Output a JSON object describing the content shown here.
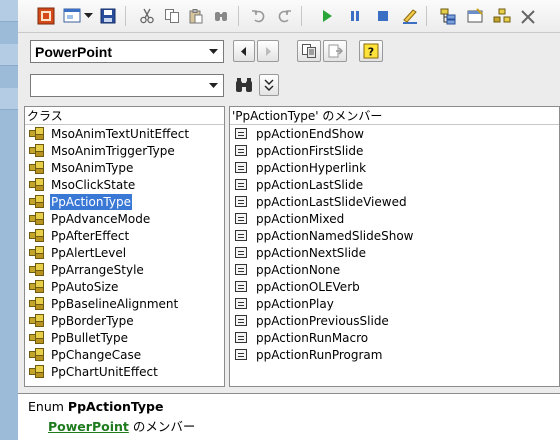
{
  "toolbar": {
    "icons": [
      "excel-view-icon",
      "insert-userform-icon",
      "dropdown-chevron-icon",
      "save-icon",
      "cut-icon",
      "copy-icon",
      "paste-icon",
      "find-icon",
      "undo-icon",
      "redo-icon",
      "run-icon",
      "break-icon",
      "reset-icon",
      "design-mode-icon",
      "project-explorer-icon",
      "properties-icon",
      "object-browser-icon",
      "toolbox-icon"
    ]
  },
  "library_select": {
    "value": "PowerPoint"
  },
  "search_select": {
    "value": ""
  },
  "classes": {
    "header": "クラス",
    "items": [
      "MsoAnimTextUnitEffect",
      "MsoAnimTriggerType",
      "MsoAnimType",
      "MsoClickState",
      "PpActionType",
      "PpAdvanceMode",
      "PpAfterEffect",
      "PpAlertLevel",
      "PpArrangeStyle",
      "PpAutoSize",
      "PpBaselineAlignment",
      "PpBorderType",
      "PpBulletType",
      "PpChangeCase",
      "PpChartUnitEffect"
    ],
    "selected": "PpActionType"
  },
  "members": {
    "header": "'PpActionType' のメンバー",
    "items": [
      "ppActionEndShow",
      "ppActionFirstSlide",
      "ppActionHyperlink",
      "ppActionLastSlide",
      "ppActionLastSlideViewed",
      "ppActionMixed",
      "ppActionNamedSlideShow",
      "ppActionNextSlide",
      "ppActionNone",
      "ppActionOLEVerb",
      "ppActionPlay",
      "ppActionPreviousSlide",
      "ppActionRunMacro",
      "ppActionRunProgram"
    ]
  },
  "details": {
    "kind": "Enum",
    "name": "PpActionType",
    "library_link": "PowerPoint",
    "member_of": "のメンバー"
  },
  "colors": {
    "selection": "#3a78d6",
    "link": "#1e7b1e",
    "left_strip": "#9cbbd9"
  }
}
